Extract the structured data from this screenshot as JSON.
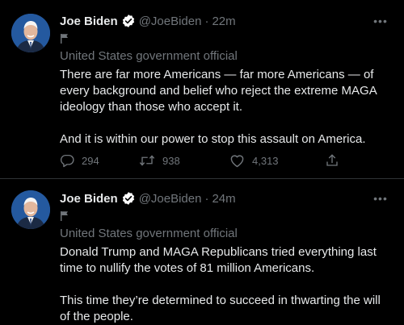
{
  "tweets": [
    {
      "author_name": "Joe Biden",
      "handle": "@JoeBiden",
      "separator": "·",
      "time": "22m",
      "label": "United States government official",
      "text": "There are far more Americans — far more Americans — of every background and belief who reject the extreme MAGA ideology than those who accept it.\n\nAnd it is within our power to stop this assault on America.",
      "replies": "294",
      "retweets": "938",
      "likes": "4,313"
    },
    {
      "author_name": "Joe Biden",
      "handle": "@JoeBiden",
      "separator": "·",
      "time": "24m",
      "label": "United States government official",
      "text": "Donald Trump and MAGA Republicans tried everything last time to nullify the votes of 81 million Americans.\n\nThis time they’re determined to succeed in thwarting the will of the people."
    }
  ],
  "more_glyph": "•••",
  "colors": {
    "background": "#000000",
    "primary_text": "#e7e9ea",
    "secondary_text": "#71767b",
    "divider": "#2f3336",
    "verified_badge": "#ffffff"
  },
  "icons": [
    "verified-badge-icon",
    "government-flag-icon",
    "more-options-icon",
    "reply-icon",
    "retweet-icon",
    "like-icon",
    "share-icon"
  ]
}
